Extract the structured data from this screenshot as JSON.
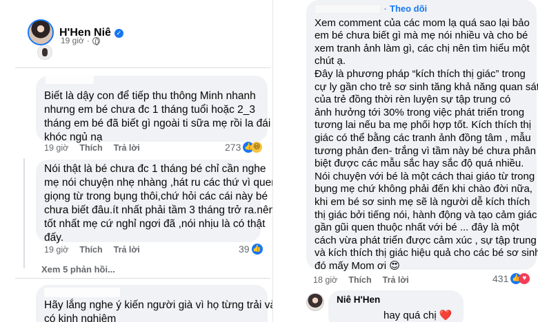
{
  "post": {
    "author": "H'Hen Niê",
    "time": "19 giờ"
  },
  "left_comments": [
    {
      "lines": [
        "Biết là dậy con để tiếp thu thông Minh nhanh",
        "nhưng em bé chưa đc 1 tháng tuổi hoặc 2_3",
        "tháng em bé đã biết gì ngoài ti sữa mẹ rồi la đái",
        "khóc ngủ nạ"
      ],
      "time": "19 giờ",
      "like": "Thích",
      "reply": "Trả lời",
      "reactions": "273"
    },
    {
      "lines": [
        "Nói thật là bé chưa đc 1 tháng bé chỉ cần nghe",
        "mẹ nói chuyện nhẹ nhàng ,hát ru các thứ vì quen",
        "giọng từ trong bụng thôi,chứ hỏi các cái này bé",
        "chưa biết đâu.ít nhất phải tầm 3 tháng trở ra.nên",
        "tốt nhất mẹ cứ nghỉ ngơi đã ,nói nhịu là có thật",
        "đấy."
      ],
      "time": "19 giờ",
      "like": "Thích",
      "reply": "Trả lời",
      "reactions": "39"
    },
    {
      "lines": [
        "Hãy lắng nghe ý kiến người già vì họ từng trải và",
        "có kinh nghiệm"
      ]
    }
  ],
  "more_replies": "Xem 5 phản hồi...",
  "right_comment": {
    "follow": "Theo dõi",
    "lines": [
      "Xem comment của các mom lạ quá sao lại bảo",
      "em bé chưa biết gì mà mẹ nói nhiều và cho bé",
      "xem tranh ảnh làm gì, các chị nên tìm hiểu một",
      "chút ạ.",
      "Đây là phương pháp “kích thích thị giác” trong",
      "cự ly gần cho trẻ sơ sinh tăng khả năng quan sát",
      "của trẻ đồng thời rèn luyện sự tập trung có",
      "ảnh hưởng tới 30% trong việc phát triển trong",
      "tương lai nếu ba mẹ phối hợp tốt. Kích thích thị",
      "giác có thể bằng các tranh ảnh đồng tâm , mẫu",
      "tương phản đen- trắng vì tầm này bé chưa phân",
      "biệt được các mẫu sắc hay sắc độ quá nhiều.",
      "Nói chuyện với bé là một cách thai giáo từ trong",
      "bụng mẹ chứ không phải đến khi chào đời nữa,",
      "khi em bé sơ sinh mẹ sẽ là người dễ kích thích",
      "thị giác bởi tiếng nói, hành động và tạo cảm giác",
      "gần gũi quen thuộc nhất với bé ... đây là một",
      "cách vừa phát triển được cảm xúc , sự tập trung",
      "và kích thích thị giác hiệu quả cho các bé sơ sinh",
      "đó mấy Mom ơi 😍"
    ],
    "time": "18 giờ",
    "like": "Thích",
    "reply": "Trả lời",
    "reactions": "431"
  },
  "reply": {
    "author": "Niê H'Hen",
    "text": "hay quá chị ❤️"
  },
  "colors": {
    "accent": "#1877f2",
    "bubble": "#f0f2f5",
    "meta": "#65676b"
  }
}
